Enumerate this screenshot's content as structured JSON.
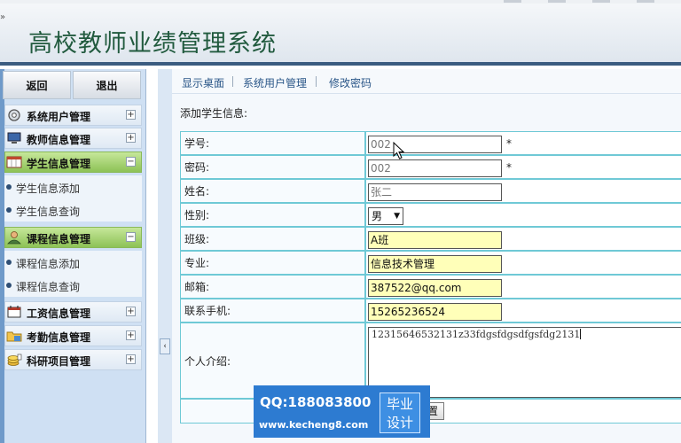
{
  "header": {
    "title": "高校教师业绩管理系统",
    "corner_mark": "»"
  },
  "sidebar": {
    "top_buttons": {
      "back": "返回",
      "logout": "退出"
    },
    "categories": [
      {
        "label": "系统用户管理",
        "icon": "gear-icon",
        "toggle": "+"
      },
      {
        "label": "教师信息管理",
        "icon": "monitor-icon",
        "toggle": "+"
      },
      {
        "label": "学生信息管理",
        "icon": "calendar-table-icon",
        "toggle": "−"
      },
      {
        "label": "课程信息管理",
        "icon": "user-icon",
        "toggle": "−"
      },
      {
        "label": "工资信息管理",
        "icon": "calendar-icon",
        "toggle": "+"
      },
      {
        "label": "考勤信息管理",
        "icon": "folder-icon",
        "toggle": "+"
      },
      {
        "label": "科研项目管理",
        "icon": "coins-icon",
        "toggle": "+"
      }
    ],
    "student_items": [
      "学生信息添加",
      "学生信息查询"
    ],
    "course_items": [
      "课程信息添加",
      "课程信息查询"
    ],
    "collapse_glyph": "‹"
  },
  "main": {
    "tabs": [
      "显示桌面",
      "系统用户管理",
      "修改密码"
    ],
    "section_title": "添加学生信息:",
    "form": {
      "student_id": {
        "label": "学号:",
        "value": "002",
        "required": "*"
      },
      "password": {
        "label": "密码:",
        "value": "002",
        "required": "*"
      },
      "name": {
        "label": "姓名:",
        "value": "张二"
      },
      "gender": {
        "label": "性别:",
        "value": "男",
        "caret": "▼"
      },
      "class": {
        "label": "班级:",
        "value": "A班"
      },
      "major": {
        "label": "专业:",
        "value": "信息技术管理"
      },
      "email": {
        "label": "邮箱:",
        "value": "387522@qq.com"
      },
      "phone": {
        "label": "联系手机:",
        "value": "15265236524"
      },
      "intro": {
        "label": "个人介绍:",
        "value": "12315646532131z33fdgsfdgsdfgsfdg2131"
      }
    },
    "reset_label": "置"
  },
  "watermark": {
    "qq": "QQ:188083800",
    "url": "www.kecheng8.com",
    "badge_top": "毕业",
    "badge_bottom": "设计"
  },
  "colors": {
    "header_title": "#215a3e",
    "active_menu": "#8dc256",
    "highlight_field": "#ffffb9",
    "table_border": "#6fc9d6",
    "watermark_bg": "#2d7bd1"
  }
}
